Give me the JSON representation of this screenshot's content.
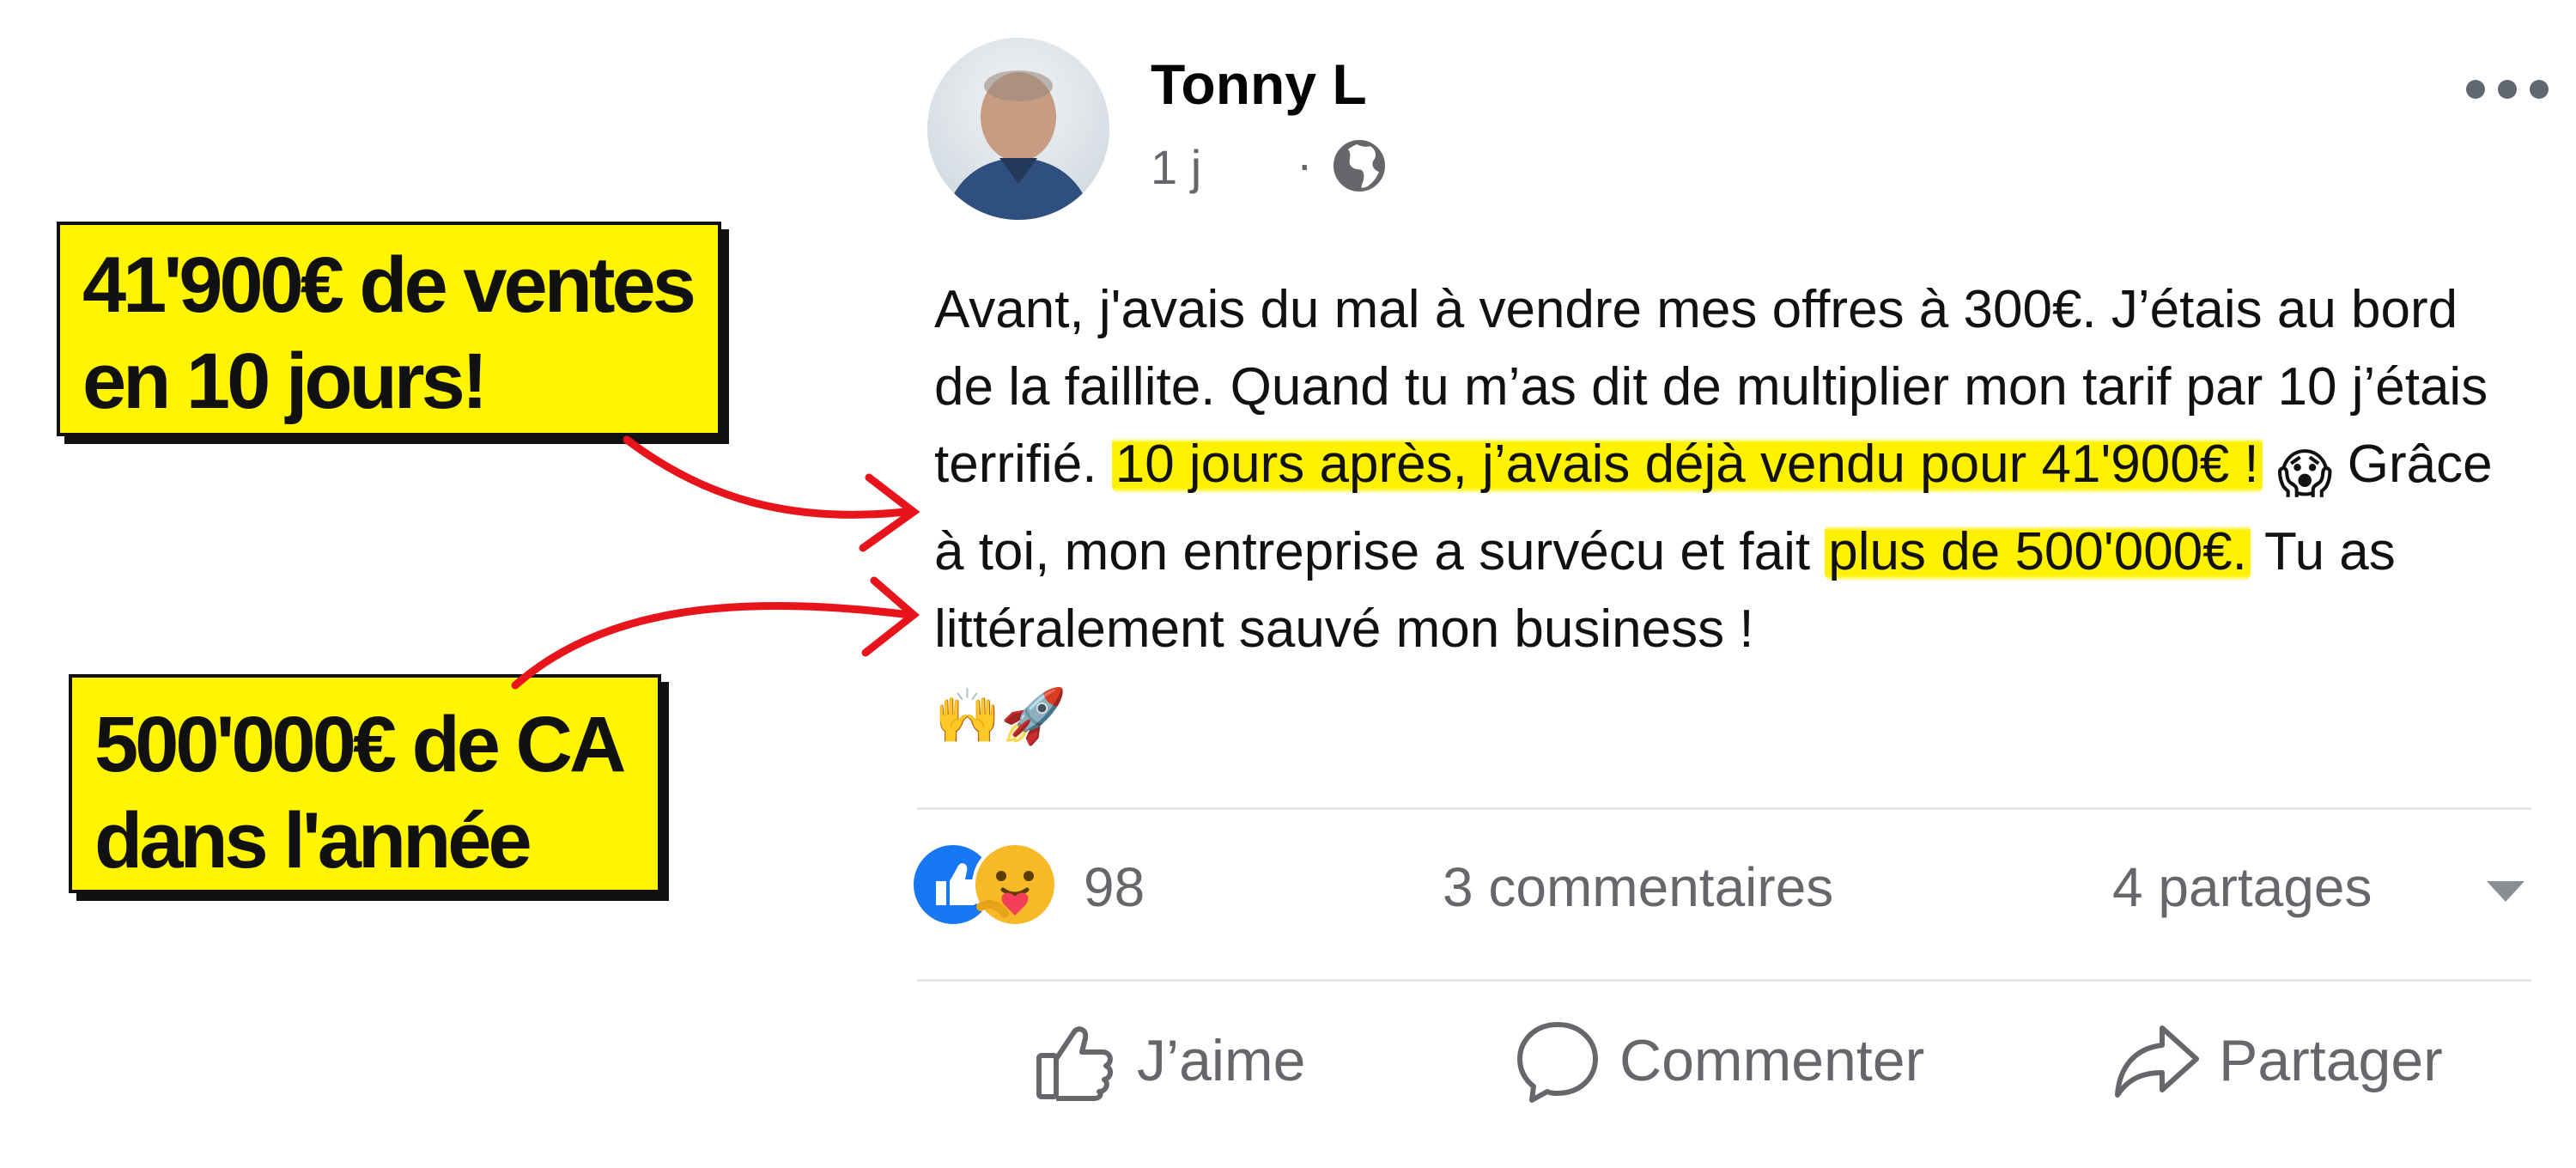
{
  "callouts": [
    {
      "line1": "41'900€ de ventes",
      "line2": "en 10 jours!"
    },
    {
      "line1": "500'000€ de CA",
      "line2": "dans l'année"
    }
  ],
  "post": {
    "author": "Tonny L",
    "time": "1 j",
    "separator": "·",
    "body": {
      "part1": "Avant, j'avais du mal à vendre mes offres à 300€. J’étais au bord de la faillite. Quand tu m’as dit de multiplier mon tarif par 10  j’étais terrifié. ",
      "highlight1": "10 jours après, j’avais déjà vendu pour 41'900€ !",
      "emoji1": "😱",
      "part2": " Grâce à toi, mon entreprise a survécu et fait ",
      "highlight2": "plus de 500'000€.",
      "part3": " Tu as littéralement sauvé mon business !",
      "emoji2": "🙌",
      "emoji3": "🚀"
    }
  },
  "stats": {
    "reactions": "98",
    "comments": "3 commentaires",
    "shares": "4 partages"
  },
  "actions": {
    "like": "J’aime",
    "comment": "Commenter",
    "share": "Partager"
  },
  "colors": {
    "highlight": "#fff200",
    "callout_bg": "#fff500",
    "arrow": "#e8141c",
    "meta_text": "#65676b",
    "like_blue": "#1877f2"
  },
  "icons": [
    "globe-icon",
    "more-dots-icon",
    "like-reaction-icon",
    "care-reaction-icon",
    "caret-down-icon",
    "thumbs-up-icon",
    "comment-bubble-icon",
    "share-arrow-icon"
  ]
}
